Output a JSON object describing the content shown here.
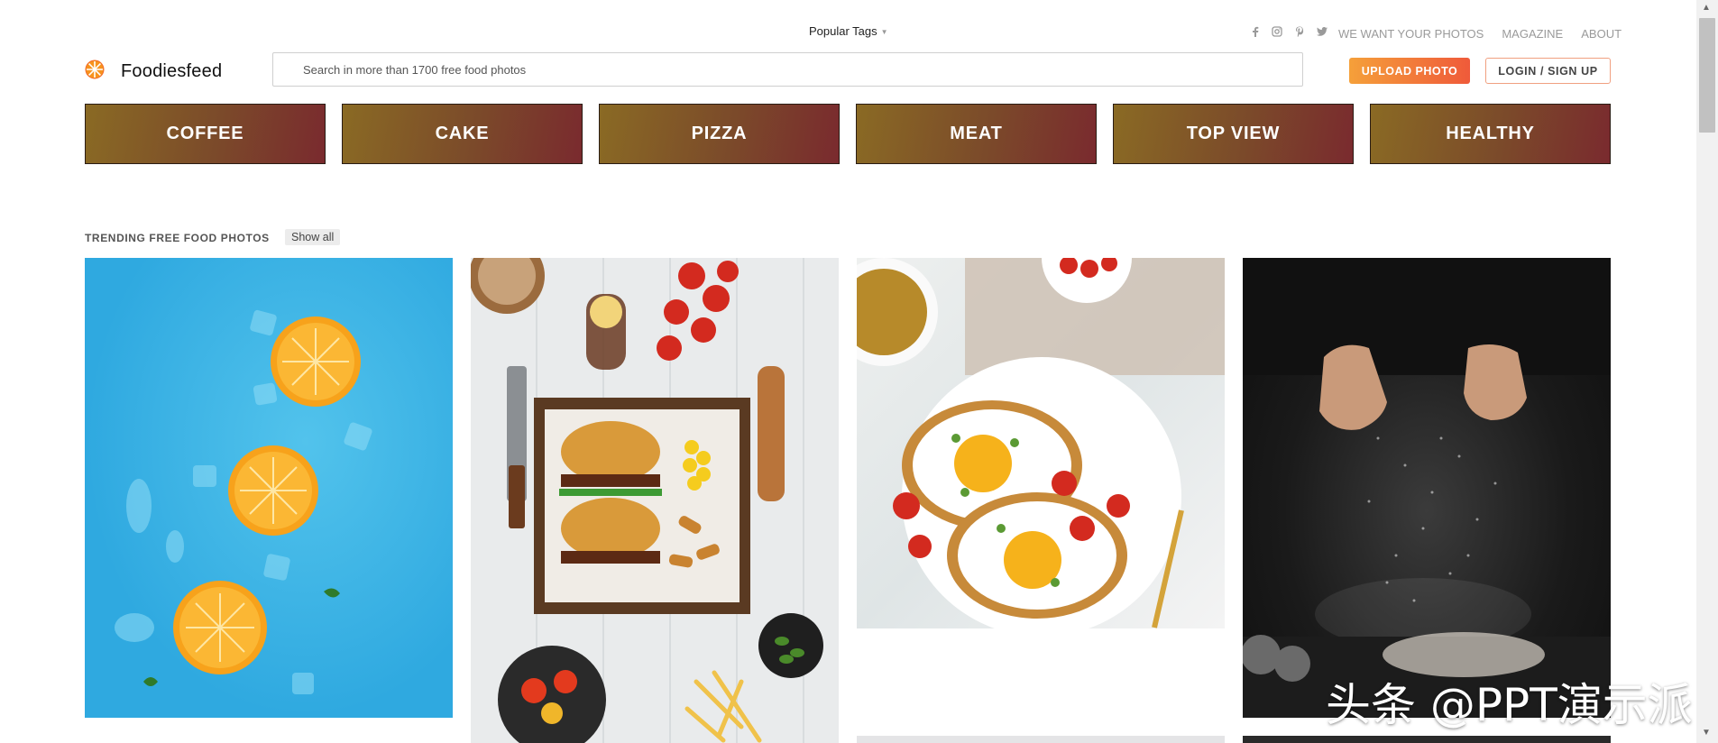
{
  "header": {
    "popular_tags": "Popular Tags",
    "nav": [
      "WE WANT YOUR PHOTOS",
      "MAGAZINE",
      "ABOUT"
    ],
    "social_icons": [
      "facebook-icon",
      "instagram-icon",
      "pinterest-icon",
      "twitter-icon"
    ]
  },
  "logo": {
    "text": "Foodiesfeed"
  },
  "search": {
    "placeholder": "Search in more than 1700 free food photos",
    "value": ""
  },
  "buttons": {
    "upload": "UPLOAD PHOTO",
    "login": "LOGIN / SIGN UP"
  },
  "categories": [
    "COFFEE",
    "CAKE",
    "PIZZA",
    "MEAT",
    "TOP VIEW",
    "HEALTHY"
  ],
  "trending": {
    "title": "TRENDING FREE FOOD PHOTOS",
    "show_all": "Show all"
  },
  "watermark": "头条 @PPT演示派",
  "colors": {
    "accent_start": "#f5a03a",
    "accent_end": "#ef5a3a",
    "category_gold": "#8a6a24",
    "category_red": "#7a2a2e"
  }
}
